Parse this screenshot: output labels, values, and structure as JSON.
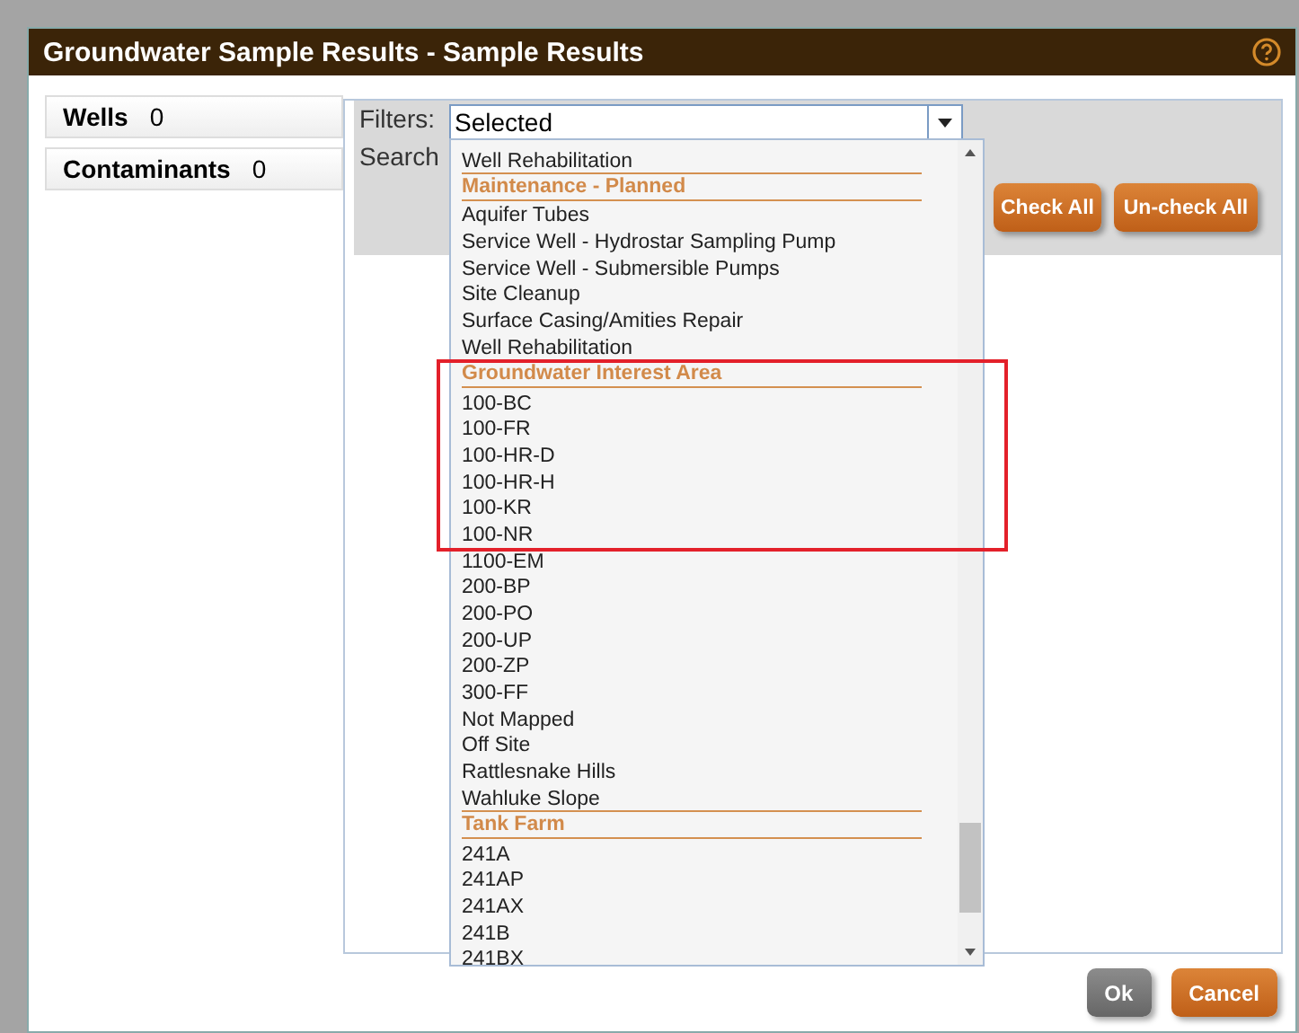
{
  "window": {
    "title": "Groundwater Sample Results - Sample Results"
  },
  "side_tabs": [
    {
      "label": "Wells",
      "count": "0"
    },
    {
      "label": "Contaminants",
      "count": "0"
    }
  ],
  "filters": {
    "label": "Filters:",
    "value": "Selected"
  },
  "search": {
    "label": "Search"
  },
  "list": [
    {
      "kind": "item",
      "label": "Well Rehabilitation"
    },
    {
      "kind": "header",
      "label": "Maintenance - Planned"
    },
    {
      "kind": "item",
      "label": "Aquifer Tubes"
    },
    {
      "kind": "item",
      "label": "Service Well - Hydrostar Sampling Pump"
    },
    {
      "kind": "item",
      "label": "Service Well - Submersible Pumps"
    },
    {
      "kind": "item",
      "label": "Site Cleanup"
    },
    {
      "kind": "item",
      "label": "Surface Casing/Amities Repair"
    },
    {
      "kind": "item",
      "label": "Well Rehabilitation"
    },
    {
      "kind": "header",
      "label": "Groundwater Interest Area"
    },
    {
      "kind": "item",
      "label": "100-BC"
    },
    {
      "kind": "item",
      "label": "100-FR"
    },
    {
      "kind": "item",
      "label": "100-HR-D"
    },
    {
      "kind": "item",
      "label": "100-HR-H"
    },
    {
      "kind": "item",
      "label": "100-KR"
    },
    {
      "kind": "item",
      "label": "100-NR"
    },
    {
      "kind": "item",
      "label": "1100-EM"
    },
    {
      "kind": "item",
      "label": "200-BP"
    },
    {
      "kind": "item",
      "label": "200-PO"
    },
    {
      "kind": "item",
      "label": "200-UP"
    },
    {
      "kind": "item",
      "label": "200-ZP"
    },
    {
      "kind": "item",
      "label": "300-FF"
    },
    {
      "kind": "item",
      "label": "Not Mapped"
    },
    {
      "kind": "item",
      "label": "Off Site"
    },
    {
      "kind": "item",
      "label": "Rattlesnake Hills"
    },
    {
      "kind": "item",
      "label": "Wahluke Slope"
    },
    {
      "kind": "header",
      "label": "Tank Farm"
    },
    {
      "kind": "item",
      "label": "241A"
    },
    {
      "kind": "item",
      "label": "241AP"
    },
    {
      "kind": "item",
      "label": "241AX"
    },
    {
      "kind": "item",
      "label": "241B"
    },
    {
      "kind": "item",
      "label": "241BX"
    }
  ],
  "panel_buttons": [
    {
      "label": "Check All",
      "kind": "primary"
    },
    {
      "label": "Un-check All",
      "kind": "primary"
    }
  ],
  "footer_buttons": [
    {
      "label": "Ok",
      "kind": "secondary"
    },
    {
      "label": "Cancel",
      "kind": "primary"
    }
  ]
}
